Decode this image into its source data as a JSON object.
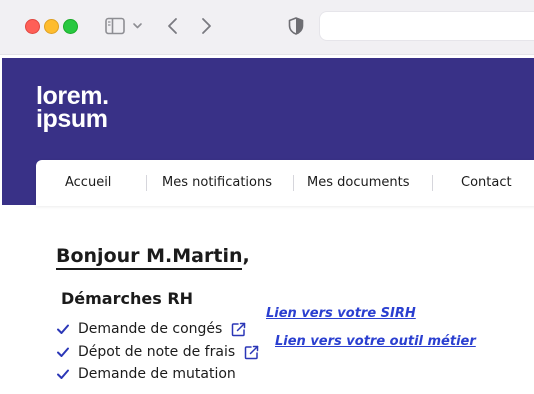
{
  "browser": {
    "icons": [
      "close-dot",
      "minimize-dot",
      "zoom-dot",
      "sidebar-icon",
      "chevron-down-icon",
      "back-arrow-icon",
      "forward-arrow-icon",
      "shield-icon"
    ]
  },
  "brand": {
    "line1": "lorem.",
    "line2": "ipsum",
    "color": "#393187"
  },
  "nav": {
    "items": [
      {
        "label": "Accueil"
      },
      {
        "label": "Mes notifications"
      },
      {
        "label": "Mes documents"
      },
      {
        "label": "Contact"
      }
    ]
  },
  "main": {
    "greeting_name": "Bonjour M.Martin",
    "greeting_suffix": ",",
    "section_title": "Démarches RH",
    "tasks": [
      {
        "label": "Demande de congés",
        "icon": "external-link-icon"
      },
      {
        "label": "Dépot de note de frais",
        "icon": "external-link-icon"
      },
      {
        "label": "Demande de mutation"
      }
    ],
    "links": [
      {
        "label": "Lien vers votre SIRH"
      },
      {
        "label": "Lien vers votre outil métier"
      }
    ],
    "link_color": "#2a3fd0"
  }
}
